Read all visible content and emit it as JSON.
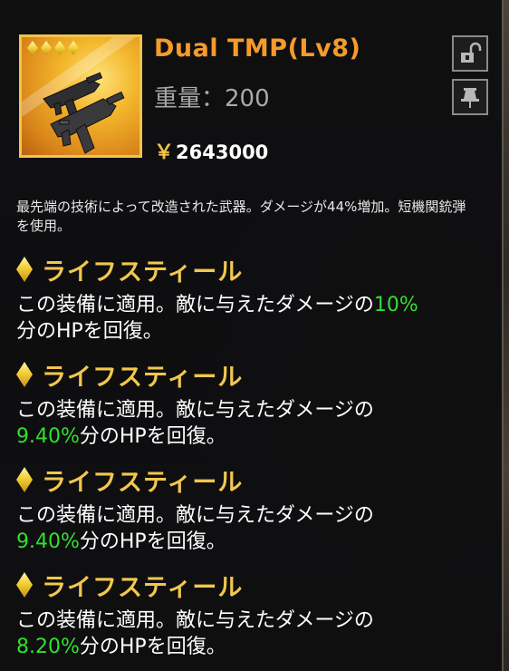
{
  "item": {
    "name": "Dual TMP(Lv8)",
    "rarity_stars": 4,
    "weight_label": "重量：",
    "weight_value": "200",
    "price_symbol": "￥",
    "price_value": "2643000",
    "description": "最先端の技術によって改造された武器。ダメージが44%増加。短機関銃弾を使用。"
  },
  "buttons": {
    "lock_icon": "unlock-icon",
    "pin_icon": "pin-icon"
  },
  "skills": [
    {
      "name": "ライフスティール",
      "text_before": "この装備に適用。敵に与えたダメージの",
      "value": "10%",
      "text_after": "分のHPを回復。"
    },
    {
      "name": "ライフスティール",
      "text_before": "この装備に適用。敵に与えたダメージの",
      "value": "9.40%",
      "text_after": "分のHPを回復。"
    },
    {
      "name": "ライフスティール",
      "text_before": "この装備に適用。敵に与えたダメージの",
      "value": "9.40%",
      "text_after": "分のHPを回復。"
    },
    {
      "name": "ライフスティール",
      "text_before": "この装備に適用。敵に与えたダメージの",
      "value": "8.20%",
      "text_after": "分のHPを回復。"
    }
  ],
  "colors": {
    "title": "#f59a2c",
    "skill_name": "#f2c74e",
    "highlight_value": "#2fe02f",
    "frame_gold": "#f1c54a"
  }
}
